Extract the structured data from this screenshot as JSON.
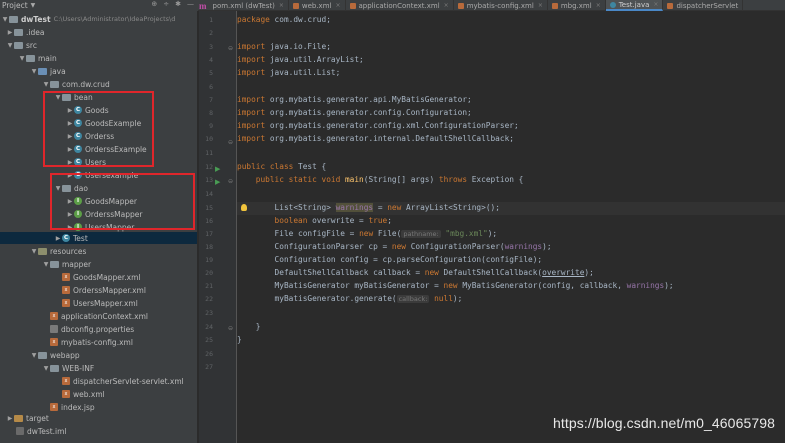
{
  "project_panel": {
    "title": "Project",
    "tools": [
      "⚙",
      "÷",
      "⚙",
      "—"
    ]
  },
  "tabs": [
    {
      "label": "pom.xml (dwTest)",
      "color": "#c14da8",
      "active": false
    },
    {
      "label": "web.xml",
      "color": "#b86a3b",
      "active": false
    },
    {
      "label": "applicationContext.xml",
      "color": "#b86a3b",
      "active": false
    },
    {
      "label": "mybatis-config.xml",
      "color": "#b86a3b",
      "active": false
    },
    {
      "label": "mbg.xml",
      "color": "#b86a3b",
      "active": false
    },
    {
      "label": "Test.java",
      "color": "#3e86a0",
      "active": true
    },
    {
      "label": "dispatcherServlet",
      "color": "#b86a3b",
      "active": false
    }
  ],
  "tree": {
    "root_name": "dwTest",
    "root_path": "C:\\Users\\Administrator\\IdeaProjects\\d",
    "idea": ".idea",
    "src": "src",
    "main": "main",
    "java": "java",
    "package": "com.dw.crud",
    "bean": "bean",
    "goods": "Goods",
    "goods_example": "GoodsExample",
    "orderss": "Orderss",
    "orderss_example": "OrderssExample",
    "users": "Users",
    "users_example": "Usersexample",
    "dao": "dao",
    "goods_mapper": "GoodsMapper",
    "orderss_mapper": "OrderssMapper",
    "users_mapper": "UsersMapper",
    "test": "Test",
    "resources": "resources",
    "mapper": "mapper",
    "goods_mapper_xml": "GoodsMapper.xml",
    "orderss_mapper_xml": "OrderssMapper.xml",
    "users_mapper_xml": "UsersMapper.xml",
    "app_context": "applicationContext.xml",
    "dbconfig": "dbconfig.properties",
    "mybatis_config": "mybatis-config.xml",
    "webapp": "webapp",
    "web_inf": "WEB-INF",
    "dispatcher": "dispatcherServlet-servlet.xml",
    "web_xml": "web.xml",
    "index_jsp": "index.jsp",
    "target": "target",
    "dwtest_iml": "dwTest.iml"
  },
  "line_numbers": [
    "1",
    "2",
    "3",
    "4",
    "5",
    "6",
    "7",
    "8",
    "9",
    "10",
    "11",
    "12",
    "13",
    "14",
    "15",
    "16",
    "17",
    "18",
    "19",
    "20",
    "21",
    "22",
    "23",
    "24",
    "25",
    "26",
    "27"
  ],
  "code": {
    "l1_kw": "package",
    "l1_rest": " com.dw.crud;",
    "l3_kw": "import",
    "l3_rest": " java.io.File;",
    "l4_kw": "import",
    "l4_rest": " java.util.ArrayList;",
    "l5_kw": "import",
    "l5_rest": " java.util.List;",
    "l7_kw": "import",
    "l7_rest": " org.mybatis.generator.api.MyBatisGenerator;",
    "l8_kw": "import",
    "l8_rest": " org.mybatis.generator.config.Configuration;",
    "l9_kw": "import",
    "l9_rest": " org.mybatis.generator.config.xml.ConfigurationParser;",
    "l10_kw": "import",
    "l10_rest": " org.mybatis.generator.internal.DefaultShellCallback;",
    "l12_kw": "public class",
    "l12_rest": " Test {",
    "l13_kw1": "    public static void",
    "l13_fn": " main",
    "l13_mid": "(String[] args) ",
    "l13_kw2": "throws",
    "l13_rest": " Exception {",
    "l15_a": "        List<String> ",
    "l15_b": "warnings",
    "l15_c": " = ",
    "l15_kw": "new",
    "l15_d": " ArrayList<String>();",
    "l16_kw": "        boolean",
    "l16_a": " overwrite = ",
    "l16_kw2": "true",
    "l16_b": ";",
    "l17_a": "        File configFile = ",
    "l17_kw": "new",
    "l17_b": " File(",
    "l17_hint": "pathname:",
    "l17_str": " \"mbg.xml\"",
    "l17_c": ");",
    "l18_a": "        ConfigurationParser cp = ",
    "l18_kw": "new",
    "l18_b": " ConfigurationParser(",
    "l18_w": "warnings",
    "l18_c": ");",
    "l19": "        Configuration config = cp.parseConfiguration(configFile);",
    "l20_a": "        DefaultShellCallback callback = ",
    "l20_kw": "new",
    "l20_b": " DefaultShellCallback(",
    "l20_u": "overwrite",
    "l20_c": ");",
    "l21_a": "        MyBatisGenerator myBatisGenerator = ",
    "l21_kw": "new",
    "l21_b": " MyBatisGenerator(config, callback, ",
    "l21_w": "warnings",
    "l21_c": ");",
    "l22_a": "        myBatisGenerator.generate(",
    "l22_hint": "callback:",
    "l22_kw": " null",
    "l22_b": ");",
    "l24": "    }",
    "l25": "}"
  },
  "watermark": "https://blog.csdn.net/m0_46065798",
  "colors": {
    "keyword": "#cc7832",
    "string": "#6a8759",
    "highlight_box": "#e0262b",
    "selection": "#0d293e"
  }
}
